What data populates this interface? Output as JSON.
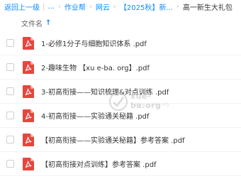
{
  "breadcrumb": {
    "back": "返回上一级",
    "ellipsis": "...",
    "items": [
      "作业帮",
      "网云",
      "【2025秋】新..."
    ],
    "current": "高一新生大礼包"
  },
  "list_header": {
    "column": "文件名",
    "sort_indicator": "↑"
  },
  "files": [
    {
      "name": "1-必修1分子与细胞知识体系 .pdf",
      "type": "pdf-icon"
    },
    {
      "name": "2-趣味生物 【xu e-ba. org】.pdf",
      "type": "pdf-icon"
    },
    {
      "name": "3-初高衔接——知识梳理&对点训练 .pdf",
      "type": "pdf-icon"
    },
    {
      "name": "4-初高衔接——实验通关秘籍 .pdf",
      "type": "pdf-icon"
    },
    {
      "name": "【初高衔接——实验通关秘籍】参考答案 .pdf",
      "type": "pdf-icon"
    },
    {
      "name": "【初高衔接对点训练】参考答案 .pdf",
      "type": "pdf-icon"
    }
  ],
  "watermark": {
    "text": "xue-ba.org",
    "sub": "www.xue-ba.org"
  },
  "colors": {
    "accent": "#0a8cff",
    "pdf_red": "#e8453c"
  }
}
